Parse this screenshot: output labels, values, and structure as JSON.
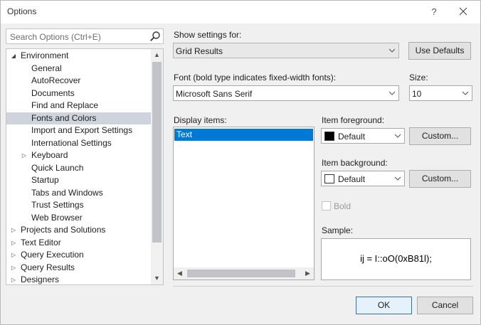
{
  "window": {
    "title": "Options",
    "help": "?"
  },
  "search": {
    "placeholder": "Search Options (Ctrl+E)"
  },
  "tree": {
    "items": [
      {
        "label": "Environment",
        "level": 0,
        "expander": "expanded"
      },
      {
        "label": "General",
        "level": 1,
        "expander": "none"
      },
      {
        "label": "AutoRecover",
        "level": 1,
        "expander": "none"
      },
      {
        "label": "Documents",
        "level": 1,
        "expander": "none"
      },
      {
        "label": "Find and Replace",
        "level": 1,
        "expander": "none"
      },
      {
        "label": "Fonts and Colors",
        "level": 1,
        "expander": "none",
        "selected": true
      },
      {
        "label": "Import and Export Settings",
        "level": 1,
        "expander": "none"
      },
      {
        "label": "International Settings",
        "level": 1,
        "expander": "none"
      },
      {
        "label": "Keyboard",
        "level": 1,
        "expander": "collapsed"
      },
      {
        "label": "Quick Launch",
        "level": 1,
        "expander": "none"
      },
      {
        "label": "Startup",
        "level": 1,
        "expander": "none"
      },
      {
        "label": "Tabs and Windows",
        "level": 1,
        "expander": "none"
      },
      {
        "label": "Trust Settings",
        "level": 1,
        "expander": "none"
      },
      {
        "label": "Web Browser",
        "level": 1,
        "expander": "none"
      },
      {
        "label": "Projects and Solutions",
        "level": 0,
        "expander": "collapsed"
      },
      {
        "label": "Text Editor",
        "level": 0,
        "expander": "collapsed"
      },
      {
        "label": "Query Execution",
        "level": 0,
        "expander": "collapsed"
      },
      {
        "label": "Query Results",
        "level": 0,
        "expander": "collapsed"
      },
      {
        "label": "Designers",
        "level": 0,
        "expander": "collapsed"
      }
    ]
  },
  "settings": {
    "show_settings_label": "Show settings for:",
    "show_settings_value": "Grid Results",
    "use_defaults": "Use Defaults",
    "font_label": "Font (bold type indicates fixed-width fonts):",
    "font_value": "Microsoft Sans Serif",
    "size_label": "Size:",
    "size_value": "10",
    "display_items_label": "Display items:",
    "display_items": [
      "Text"
    ],
    "fg_label": "Item foreground:",
    "fg_value": "Default",
    "fg_color": "#000000",
    "bg_label": "Item background:",
    "bg_value": "Default",
    "bg_color": "#ffffff",
    "custom": "Custom...",
    "bold_label": "Bold",
    "sample_label": "Sample:",
    "sample_text": "ij = I::oO(0xB81l);"
  },
  "footer": {
    "ok": "OK",
    "cancel": "Cancel"
  },
  "colors": {
    "accent": "#0078d7",
    "tree_selection": "#cfd3dd"
  }
}
